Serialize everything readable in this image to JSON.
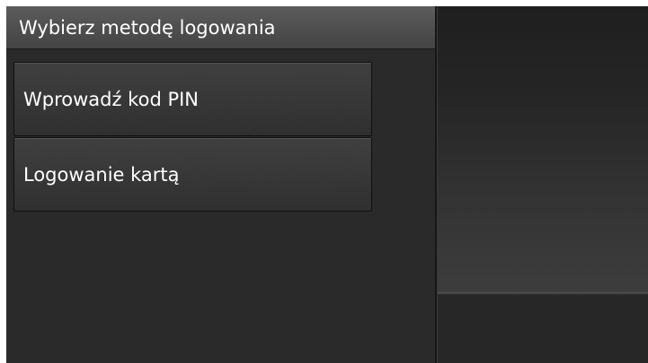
{
  "header": {
    "title": "Wybierz metodę logowania"
  },
  "menu": {
    "items": [
      {
        "label": "Wprowadź kod PIN"
      },
      {
        "label": "Logowanie kartą"
      }
    ]
  },
  "colors": {
    "background": "#2c2c2c",
    "title_bar": "#505050",
    "text": "#ffffff",
    "button": "#363636"
  }
}
